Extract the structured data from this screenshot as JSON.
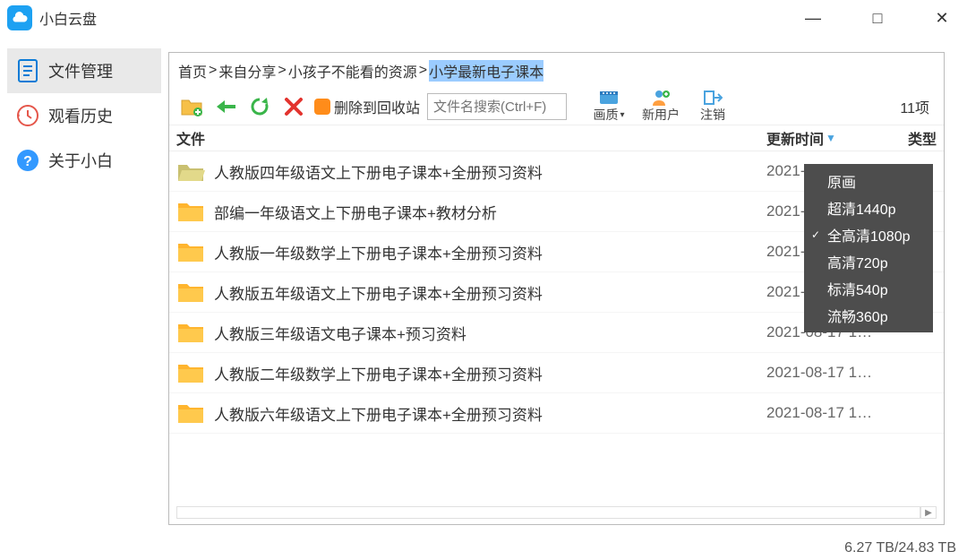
{
  "app_title": "小白云盘",
  "window_controls": {
    "min": "—",
    "max": "□",
    "close": "✕"
  },
  "sidebar": {
    "items": [
      {
        "label": "文件管理",
        "selected": true
      },
      {
        "label": "观看历史",
        "selected": false
      },
      {
        "label": "关于小白",
        "selected": false
      }
    ]
  },
  "breadcrumbs": {
    "parts": [
      "首页",
      "来自分享",
      "小孩子不能看的资源",
      "小学最新电子课本"
    ],
    "sep": ">",
    "highlight_index": 3
  },
  "toolbar": {
    "delete_label": "删除到回收站",
    "search_placeholder": "文件名搜索(Ctrl+F)",
    "quality_label": "画质",
    "newuser_label": "新用户",
    "logout_label": "注销"
  },
  "item_count_label": "11项",
  "columns": {
    "file": "文件",
    "date": "更新时间",
    "type": "类型"
  },
  "rows": [
    {
      "name": "人教版四年级语文上下册电子课本+全册预习资料",
      "date": "2021-08-17 1…",
      "open": true
    },
    {
      "name": "部编一年级语文上下册电子课本+教材分析",
      "date": "2021-08-17 1…",
      "open": false
    },
    {
      "name": "人教版一年级数学上下册电子课本+全册预习资料",
      "date": "2021-08-17 1…",
      "open": false
    },
    {
      "name": "人教版五年级语文上下册电子课本+全册预习资料",
      "date": "2021-08-17 1…",
      "open": false
    },
    {
      "name": "人教版三年级语文电子课本+预习资料",
      "date": "2021-08-17 1…",
      "open": false
    },
    {
      "name": "人教版二年级数学上下册电子课本+全册预习资料",
      "date": "2021-08-17 1…",
      "open": false
    },
    {
      "name": "人教版六年级语文上下册电子课本+全册预习资料",
      "date": "2021-08-17 1…",
      "open": false
    }
  ],
  "quality_menu": {
    "items": [
      {
        "label": "原画",
        "checked": false
      },
      {
        "label": "超清1440p",
        "checked": false
      },
      {
        "label": "全高清1080p",
        "checked": true
      },
      {
        "label": "高清720p",
        "checked": false
      },
      {
        "label": "标清540p",
        "checked": false
      },
      {
        "label": "流畅360p",
        "checked": false
      }
    ]
  },
  "status": {
    "used": "6.27 TB",
    "total": "24.83 TB",
    "sep": " / "
  }
}
